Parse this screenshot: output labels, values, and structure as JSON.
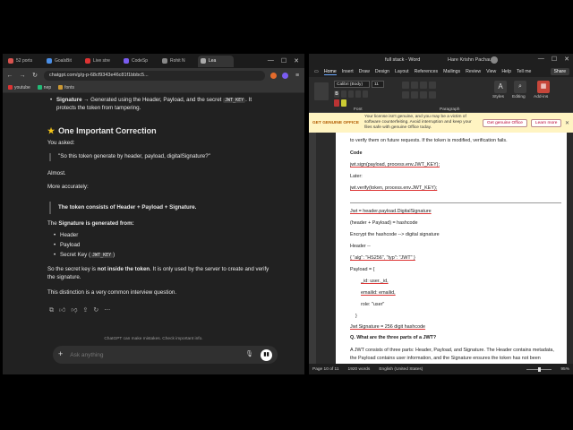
{
  "browser": {
    "tabs": [
      {
        "label": "52 ports",
        "color": "#d9534f"
      },
      {
        "label": "GoalsBit",
        "color": "#4a8fe7"
      },
      {
        "label": "Live stre",
        "color": "#d33"
      },
      {
        "label": "CodeSp",
        "color": "#7a5cf0"
      },
      {
        "label": "Rohit N",
        "color": "#888"
      },
      {
        "label": "Lea",
        "color": "#aaa"
      }
    ],
    "url": "chatgpt.com/g/g-p-68cf9343e46c81f1bbbc5...",
    "bookmarks": [
      "youtube",
      "nep",
      "fonts"
    ]
  },
  "chat": {
    "sig_bullet_bold": "Signature",
    "sig_bullet_text": " → Generated using the Header, Payload, and the secret ",
    "sig_code": "JWT_KEY",
    "sig_tail": ". It",
    "sig_line2": "protects the token from tampering.",
    "heading": "One Important Correction",
    "you_asked": "You asked:",
    "quote1": "\"So this token generate by header, payload, digitalSignature?\"",
    "almost": "Almost.",
    "more_accurately": "More accurately:",
    "quote2": "The token consists of Header + Payload + Signature.",
    "sig_gen_pre": "The ",
    "sig_gen_bold": "Signature is generated from:",
    "list": [
      "Header",
      "Payload",
      "Secret Key ("
    ],
    "list_code": "JWT_KEY",
    "list_tail": ")",
    "secret_pre": "So the secret key is ",
    "secret_bold": "not inside the token",
    "secret_post": ". It is only used by the server to create and verify",
    "secret_line2": "the signature.",
    "distinction": "This distinction is a very common interview question.",
    "footer_note": "ChatGPT can make mistakes. Check important info.",
    "composer_placeholder": "Ask anything"
  },
  "word": {
    "filename": "full stack - Word",
    "user": "Hare Krishn Pachauri",
    "tabs": [
      "Home",
      "Insert",
      "Draw",
      "Design",
      "Layout",
      "References",
      "Mailings",
      "Review",
      "View",
      "Help"
    ],
    "tell_me": "Tell me",
    "share": "Share",
    "font": "Calibri (Body)",
    "size": "11",
    "group_font": "Font",
    "group_paragraph": "Paragraph",
    "styles_label": "Styles",
    "editing_label": "Editing",
    "addins_label": "Add-ins",
    "notice_title": "GET GENUINE OFFICE",
    "notice_text": "Your license isn't genuine, and you may be a victim of software counterfeiting. Avoid interruption and keep your files safe with genuine Office today.",
    "notice_btn1": "Get genuine Office",
    "notice_btn2": "Learn more",
    "doc_lines": [
      "to verify them on future requests. If the token is modified, verification fails.",
      "Code",
      "jwt.sign(payload, process.env.JWT_KEY);",
      "Later:",
      "jwt.verify(token, process.env.JWT_KEY);",
      "Jwt = header.payload.DigitalSignature",
      "(header + Payload) = hashcode",
      "Encrypt the hashcode --> digital signature",
      "Header --",
      "{ \"alg\": \"HS256\", \"typ\": \"JWT\" }",
      "Payload = {",
      "_id: user._id,",
      "emailid: emailid,",
      "role: \"user\"",
      "}",
      "Jwt Signature = 256 digit hashcode",
      "Q. What are the three parts of a JWT?",
      "A JWT consists of three parts: Header, Payload, and Signature. The Header contains metadata,",
      "the Payload contains user information, and the Signature ensures the token has not been"
    ],
    "status_page": "Page 10 of 11",
    "status_words": "1920 words",
    "status_lang": "English (United States)",
    "status_zoom": "95%"
  }
}
